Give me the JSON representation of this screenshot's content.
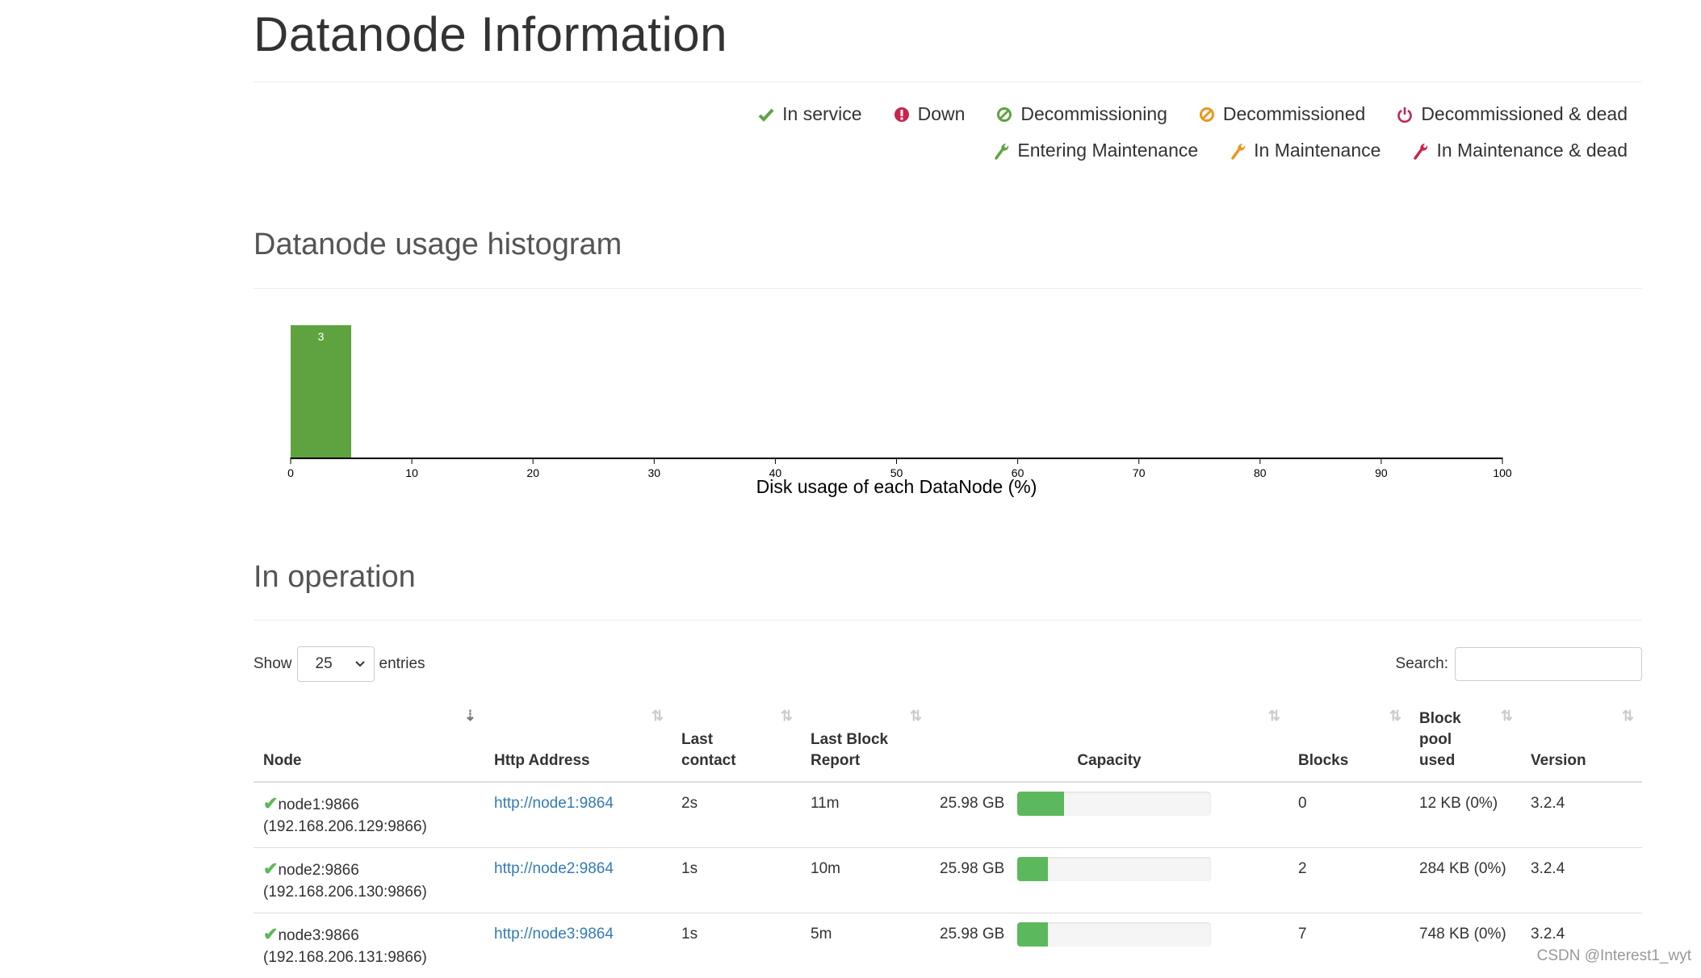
{
  "page": {
    "title": "Datanode Information"
  },
  "legend": {
    "row1": [
      {
        "icon": "checkmark-icon",
        "glyph": "✔",
        "color": "#5fa341",
        "label": "In service"
      },
      {
        "icon": "exclamation-circle-icon",
        "glyph": "!",
        "color": "#c7254e",
        "label": "Down"
      },
      {
        "icon": "ban-icon",
        "glyph": "⊘",
        "color": "#5fa341",
        "label": "Decommissioning"
      },
      {
        "icon": "ban-icon",
        "glyph": "⊘",
        "color": "#ec971f",
        "label": "Decommissioned"
      },
      {
        "icon": "power-icon",
        "glyph": "⏻",
        "color": "#c7254e",
        "label": "Decommissioned & dead"
      }
    ],
    "row2": [
      {
        "icon": "wrench-icon",
        "glyph": "🔧",
        "color": "#5fa341",
        "label": "Entering Maintenance"
      },
      {
        "icon": "wrench-icon",
        "glyph": "🔧",
        "color": "#ec971f",
        "label": "In Maintenance"
      },
      {
        "icon": "wrench-icon",
        "glyph": "🔧",
        "color": "#c7254e",
        "label": "In Maintenance & dead"
      }
    ]
  },
  "histogram": {
    "heading": "Datanode usage histogram"
  },
  "chart_data": {
    "type": "bar",
    "title": "",
    "xlabel": "Disk usage of each DataNode (%)",
    "ylabel": "",
    "bins": [
      {
        "x0": 0,
        "x1": 5,
        "count": 3
      }
    ],
    "xlim": [
      0,
      100
    ],
    "xticks": [
      0,
      10,
      20,
      30,
      40,
      50,
      60,
      70,
      80,
      90,
      100
    ],
    "ylim": [
      0,
      3
    ],
    "bar_color": "#5fa341",
    "grid": false
  },
  "operation": {
    "heading": "In operation",
    "show_label": "Show",
    "entries_value": "25",
    "entries_label": "entries",
    "search_label": "Search:",
    "search_value": "",
    "columns": [
      "Node",
      "Http Address",
      "Last contact",
      "Last Block Report",
      "Capacity",
      "Blocks",
      "Block pool used",
      "Version"
    ],
    "rows": [
      {
        "node": "node1:9866",
        "ip": "(192.168.206.129:9866)",
        "http": "http://node1:9864",
        "last_contact": "2s",
        "last_block_report": "11m",
        "capacity": "25.98 GB",
        "usage_pct": 24,
        "blocks": "0",
        "block_pool_used": "12 KB (0%)",
        "version": "3.2.4"
      },
      {
        "node": "node2:9866",
        "ip": "(192.168.206.130:9866)",
        "http": "http://node2:9864",
        "last_contact": "1s",
        "last_block_report": "10m",
        "capacity": "25.98 GB",
        "usage_pct": 16,
        "blocks": "2",
        "block_pool_used": "284 KB (0%)",
        "version": "3.2.4"
      },
      {
        "node": "node3:9866",
        "ip": "(192.168.206.131:9866)",
        "http": "http://node3:9864",
        "last_contact": "1s",
        "last_block_report": "5m",
        "capacity": "25.98 GB",
        "usage_pct": 16,
        "blocks": "7",
        "block_pool_used": "748 KB (0%)",
        "version": "3.2.4"
      }
    ]
  },
  "watermark": "CSDN @Interest1_wyt"
}
